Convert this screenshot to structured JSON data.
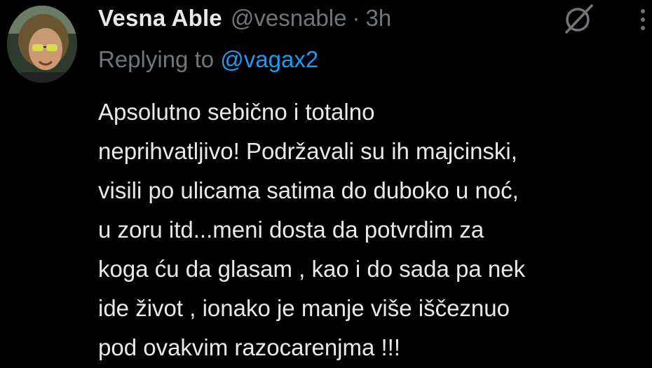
{
  "tweet": {
    "display_name": "Vesna Able",
    "handle": "@vesnable",
    "separator": "·",
    "time": "3h",
    "replying_prefix": "Replying to",
    "replying_to": "@vagax2",
    "lines": [
      "Apsolutno sebično i totalno",
      "neprihvatljivo! Podržavali su ih majcinski,",
      "visili po ulicama satima do duboko u noć,",
      "u zoru itd...meni dosta da potvrdim za",
      "koga ću da glasam , kao i do sada pa nek",
      "ide život , ionako je manje više iščeznuo",
      "pod ovakvim razocarenjma !!!"
    ]
  },
  "colors": {
    "background": "#000000",
    "primary_text": "#e7e9ea",
    "secondary_text": "#71767b",
    "link": "#1d9bf0"
  },
  "icons": {
    "avatar": "avatar",
    "grok": "grok-icon",
    "more": "more-vertical-icon"
  }
}
